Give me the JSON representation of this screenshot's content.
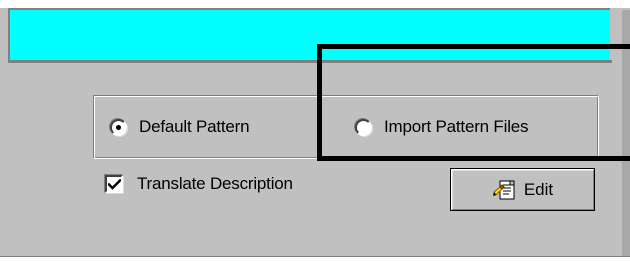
{
  "options": {
    "default_pattern_label": "Default Pattern",
    "import_pattern_label": "Import Pattern Files",
    "selected": "default"
  },
  "translate": {
    "label": "Translate Description",
    "checked": true
  },
  "edit_button": {
    "label": "Edit",
    "icon": "edit-document-icon"
  },
  "colors": {
    "window_bg": "#c0c0c0",
    "header_area": "#00ffff",
    "highlight_border": "#000000"
  }
}
